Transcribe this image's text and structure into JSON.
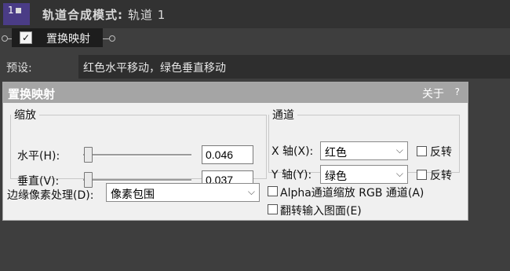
{
  "track": {
    "number": "1",
    "title": "轨道合成模式:",
    "name": "轨道 1"
  },
  "effect": {
    "name": "置换映射",
    "enabled": true
  },
  "preset": {
    "label": "预设:",
    "value": "红色水平移动，绿色垂直移动"
  },
  "dialog": {
    "title": "置换映射",
    "about": "关于",
    "help": "?",
    "zoom": {
      "legend": "缩放",
      "horizontal_label": "水平(H):",
      "horizontal_value": "0.046",
      "vertical_label": "垂直(V):",
      "vertical_value": "0.037"
    },
    "channels": {
      "legend": "通道",
      "x_label": "X 轴(X):",
      "x_value": "红色",
      "x_invert": "反转",
      "y_label": "Y 轴(Y):",
      "y_value": "绿色",
      "y_invert": "反转"
    },
    "edge": {
      "label": "边缘像素处理(D):",
      "value": "像素包围"
    },
    "options": {
      "alpha_scale": "Alpha通道缩放 RGB 通道(A)",
      "flip_input": "翻转输入图面(E)"
    }
  }
}
